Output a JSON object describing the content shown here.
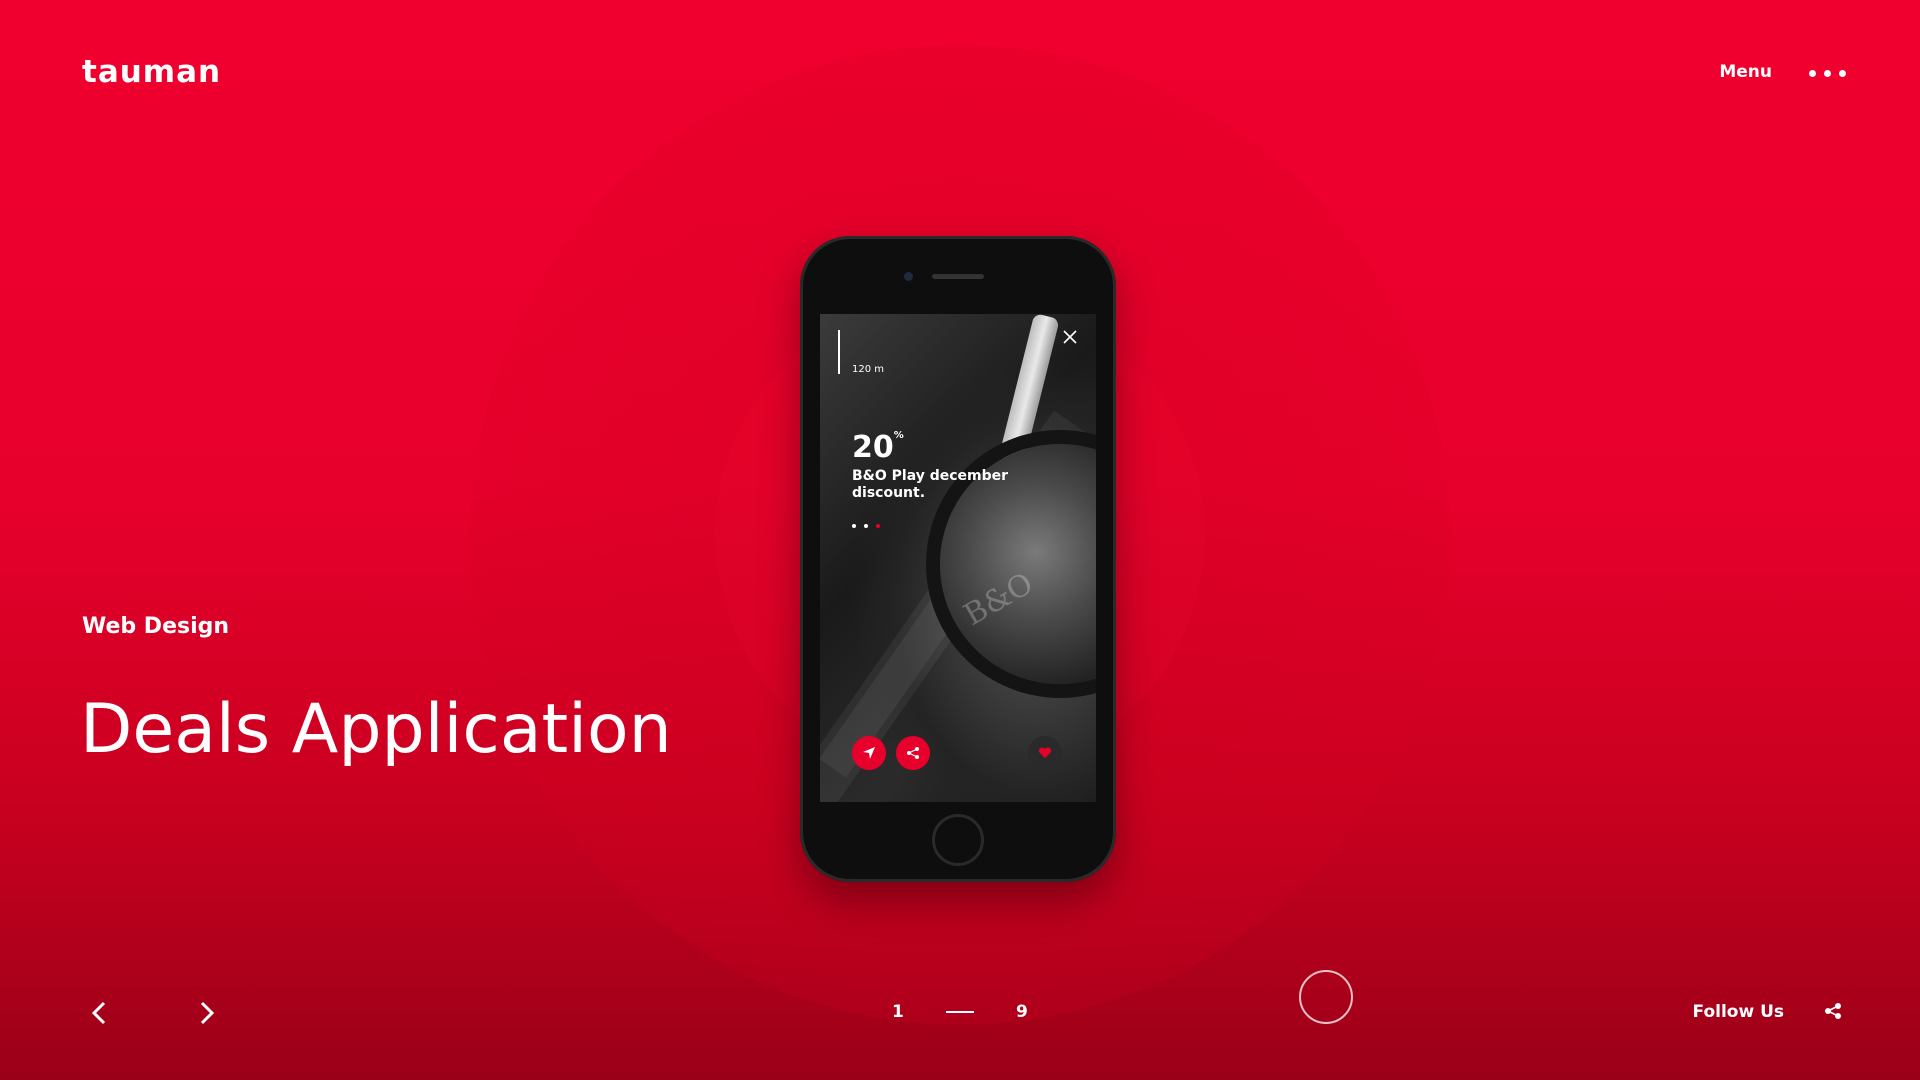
{
  "brand": {
    "logo_text": "tauman"
  },
  "header": {
    "menu_label": "Menu",
    "more_icon": "more-dots-icon"
  },
  "project": {
    "category": "Web Design",
    "title": "Deals Application"
  },
  "phone_screen": {
    "distance": "120 m",
    "discount_value": "20",
    "discount_unit": "%",
    "discount_text": "B&O Play december discount.",
    "brand_mark": "B&O",
    "close_icon": "close-icon",
    "action_icons": [
      "navigate-icon",
      "share-icon",
      "heart-icon"
    ],
    "slide_dots": 3,
    "active_dot": 3
  },
  "pagination": {
    "current": "1",
    "total": "9"
  },
  "footer": {
    "follow_label": "Follow Us",
    "share_icon": "share-icon"
  },
  "colors": {
    "accent": "#e8002c",
    "background_top": "#f0002e",
    "background_bottom": "#9a0018"
  }
}
